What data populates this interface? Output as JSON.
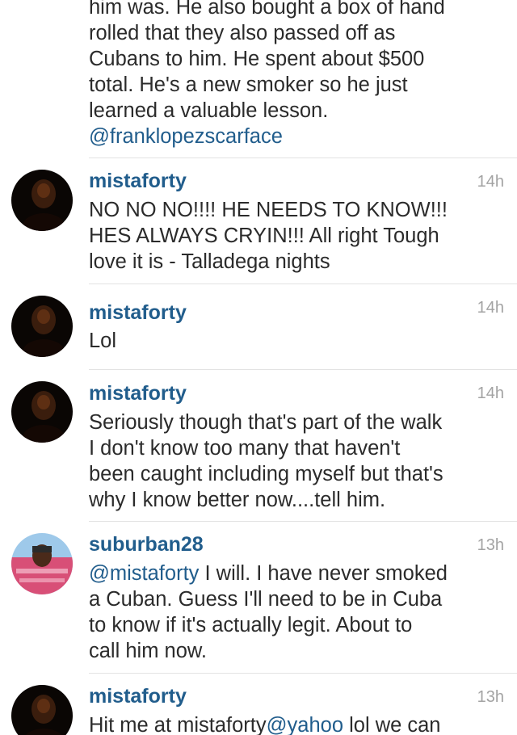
{
  "comments": [
    {
      "username": "",
      "time": "",
      "lines": [
        "him was. He also bought a box of hand",
        "rolled that they also passed off as",
        "Cubans to him. He spent about $500",
        "total. He's a new smoker so he just",
        "learned a valuable lesson."
      ],
      "mention": "@franklopezscarface"
    },
    {
      "username": "mistaforty",
      "time": "14h",
      "lines": [
        "NO NO NO!!!! HE NEEDS TO KNOW!!!",
        "HES ALWAYS CRYIN!!! All right Tough",
        "love it is - Talladega nights"
      ]
    },
    {
      "username": "mistaforty",
      "time": "14h",
      "lines": [
        "Lol"
      ]
    },
    {
      "username": "mistaforty",
      "time": "14h",
      "lines": [
        "Seriously though that's part of the walk",
        "I don't know too many that haven't",
        "been caught including myself but that's",
        "why I know better now....tell him."
      ]
    },
    {
      "username": "suburban28",
      "time": "13h",
      "mention": "@mistaforty",
      "first_line_rest": " I will. I have never smoked",
      "lines": [
        "a Cuban. Guess I'll need to be in Cuba",
        "to know if it's actually legit. About to",
        "call him now."
      ]
    },
    {
      "username": "mistaforty",
      "time": "13h",
      "line_start": "Hit me at mistaforty",
      "mention": "@yahoo",
      "line_end": " lol we can"
    }
  ],
  "colors": {
    "username": "#215d8c",
    "mention": "#215d8c",
    "text": "#2b2b2b",
    "timestamp": "#a3a3a3",
    "divider": "#e3e3e3"
  }
}
